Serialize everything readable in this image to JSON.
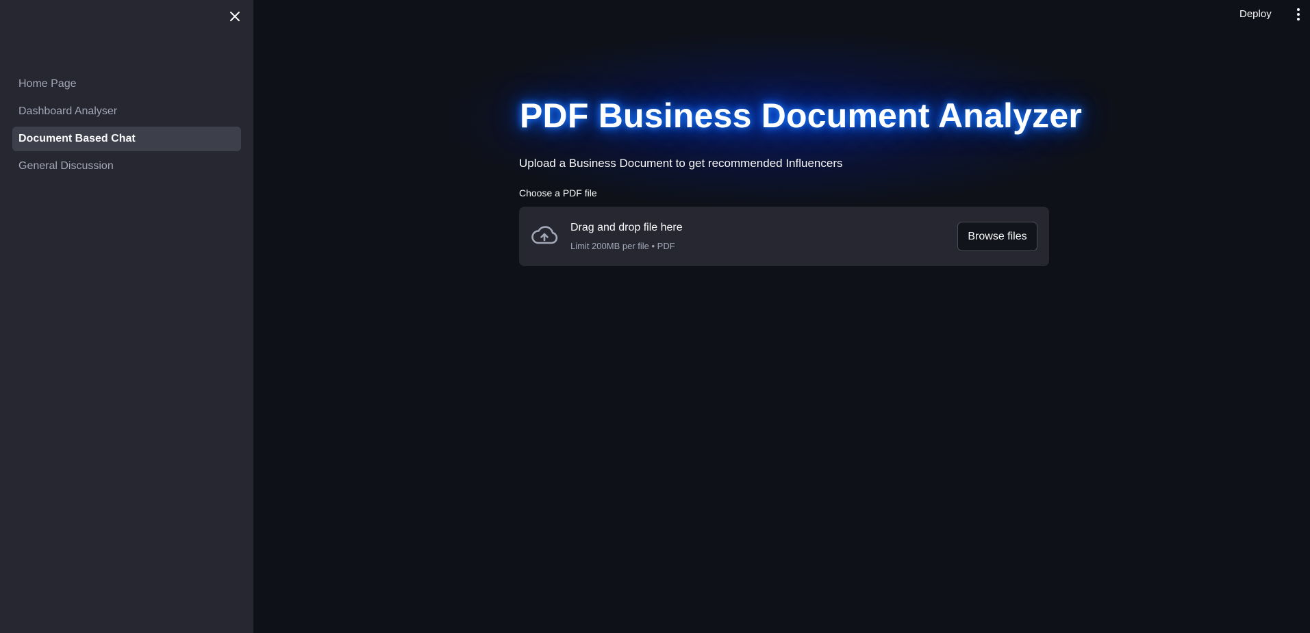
{
  "sidebar": {
    "close_icon": "close-icon",
    "items": [
      {
        "label": "Home Page",
        "active": false
      },
      {
        "label": "Dashboard Analyser",
        "active": false
      },
      {
        "label": "Document Based Chat",
        "active": true
      },
      {
        "label": "General Discussion",
        "active": false
      }
    ]
  },
  "header": {
    "deploy_label": "Deploy",
    "menu_icon": "kebab-menu-icon"
  },
  "main": {
    "title": "PDF Business Document Analyzer",
    "subtitle": "Upload a Business Document to get recommended Influencers",
    "uploader": {
      "label": "Choose a PDF file",
      "drop_text": "Drag and drop file here",
      "hint": "Limit 200MB per file • PDF",
      "browse_label": "Browse files",
      "icon": "cloud-upload-icon"
    }
  },
  "colors": {
    "background": "#0e1117",
    "sidebar": "#262730",
    "active_nav": "#3d3f4b",
    "title_glow": "#1e7fff",
    "muted_text": "#a3a8b8"
  }
}
